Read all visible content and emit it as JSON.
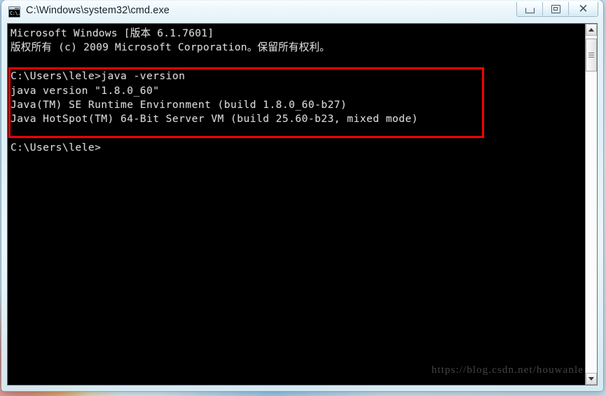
{
  "window": {
    "title": "C:\\Windows\\system32\\cmd.exe",
    "icon_name": "cmd-console-icon",
    "icon_text": "C:\\."
  },
  "caption_buttons": {
    "minimize_label": "Minimize",
    "maximize_label": "Maximize",
    "close_label": "✕",
    "close_glyph": "✕"
  },
  "console": {
    "background_color": "#000000",
    "text_color": "#d8d8d8",
    "lines": [
      {
        "text": "Microsoft Windows [版本 6.1.7601]",
        "cjk": true
      },
      {
        "text": "版权所有 (c) 2009 Microsoft Corporation。保留所有权利。",
        "cjk": true
      },
      {
        "text": "",
        "cjk": false
      },
      {
        "text": "C:\\Users\\lele>java -version",
        "cjk": false
      },
      {
        "text": "java version \"1.8.0_60\"",
        "cjk": false
      },
      {
        "text": "Java(TM) SE Runtime Environment (build 1.8.0_60-b27)",
        "cjk": false
      },
      {
        "text": "Java HotSpot(TM) 64-Bit Server VM (build 25.60-b23, mixed mode)",
        "cjk": false
      },
      {
        "text": "",
        "cjk": false
      },
      {
        "text": "C:\\Users\\lele>",
        "cjk": false
      }
    ]
  },
  "annotation": {
    "name": "red-highlight-box",
    "color": "#f70000",
    "encloses": "java -version command and its output"
  },
  "watermark": {
    "text": "https://blog.csdn.net/houwanle",
    "color": "#4a4a4a"
  },
  "scrollbar": {
    "up_arrow": "▲",
    "down_arrow": "▼",
    "orientation": "vertical"
  }
}
